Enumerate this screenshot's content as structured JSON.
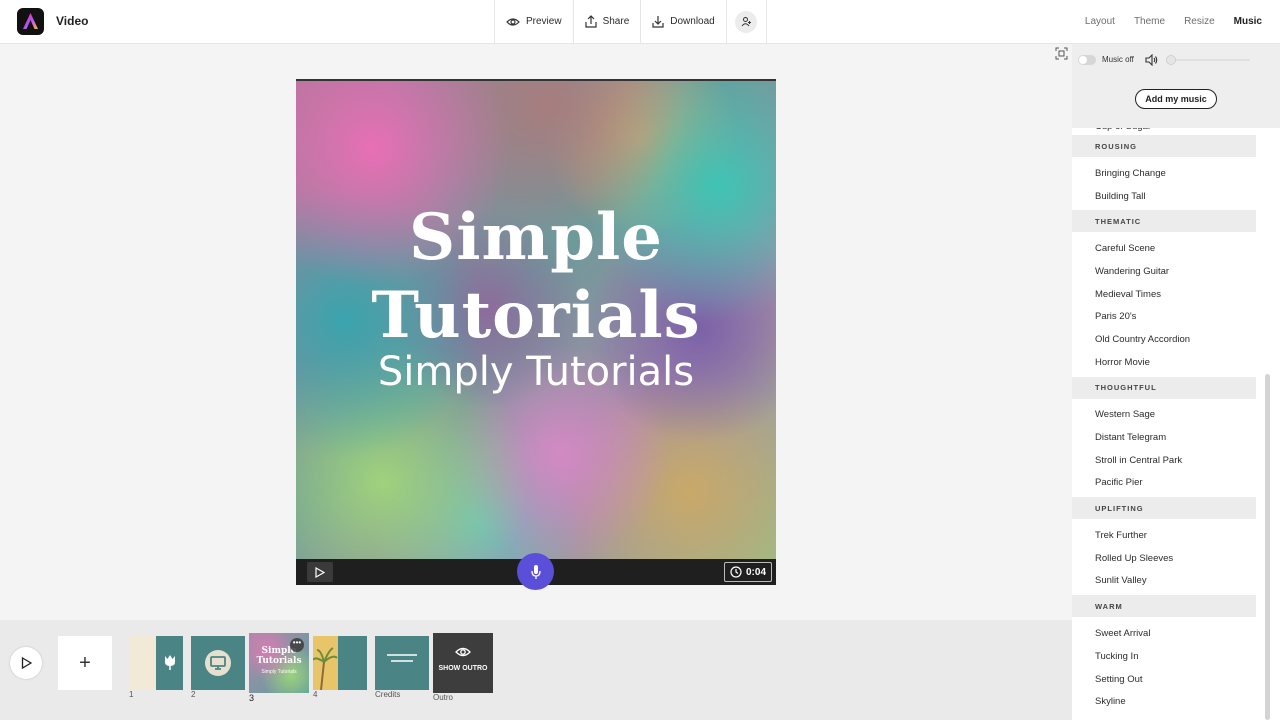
{
  "header": {
    "title": "Video",
    "actions": [
      {
        "label": "Preview",
        "icon": "eye-icon"
      },
      {
        "label": "Share",
        "icon": "share-icon"
      },
      {
        "label": "Download",
        "icon": "download-icon"
      }
    ],
    "tabs": [
      {
        "label": "Layout",
        "active": false
      },
      {
        "label": "Theme",
        "active": false
      },
      {
        "label": "Resize",
        "active": false
      },
      {
        "label": "Music",
        "active": true
      }
    ]
  },
  "canvas": {
    "title_line1": "Simple",
    "title_line2": "Tutorials",
    "subtitle": "Simply Tutorials",
    "duration": "0:04"
  },
  "timeline": {
    "slides": [
      {
        "label": "1"
      },
      {
        "label": "2"
      },
      {
        "label": "3",
        "title": "Simple Tutorials",
        "subtitle": "Simply Tutorials",
        "active": true
      },
      {
        "label": "4"
      },
      {
        "label": "Credits"
      },
      {
        "label": "Outro",
        "overlay": "SHOW OUTRO"
      }
    ]
  },
  "music": {
    "toggle_label": "Music off",
    "add_button": "Add my music",
    "clipped_song": "Cup of Sugar",
    "categories": [
      {
        "name": "ROUSING",
        "songs": [
          "Bringing Change",
          "Building Tall"
        ]
      },
      {
        "name": "THEMATIC",
        "songs": [
          "Careful Scene",
          "Wandering Guitar",
          "Medieval Times",
          "Paris 20's",
          "Old Country Accordion",
          "Horror Movie"
        ]
      },
      {
        "name": "THOUGHTFUL",
        "songs": [
          "Western Sage",
          "Distant Telegram",
          "Stroll in Central Park",
          "Pacific Pier"
        ]
      },
      {
        "name": "UPLIFTING",
        "songs": [
          "Trek Further",
          "Rolled Up Sleeves",
          "Sunlit Valley"
        ]
      },
      {
        "name": "WARM",
        "songs": [
          "Sweet Arrival",
          "Tucking In",
          "Setting Out",
          "Skyline"
        ]
      }
    ]
  },
  "colors": {
    "accent": "#5b4fd9",
    "slide_teal": "#4b8485"
  }
}
